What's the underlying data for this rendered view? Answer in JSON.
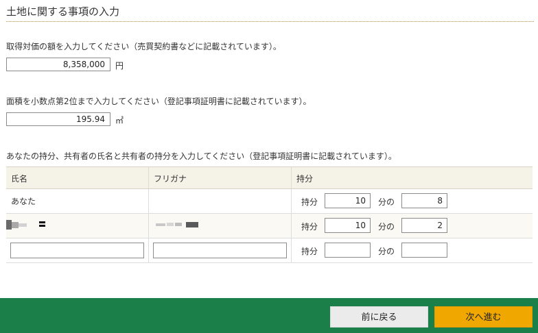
{
  "page": {
    "title": "土地に関する事項の入力"
  },
  "acquisition": {
    "prompt": "取得対価の額を入力してください（売買契約書などに記載されています）。",
    "value": "8,358,000",
    "unit": "円"
  },
  "area": {
    "prompt": "面積を小数点第2位まで入力してください（登記事項証明書に記載されています）。",
    "value": "195.94",
    "unit": "㎡"
  },
  "share": {
    "prompt": "あなたの持分、共有者の氏名と共有者の持分を入力してください（登記事項証明書に記載されています）。",
    "headers": {
      "name": "氏名",
      "furigana": "フリガナ",
      "share": "持分"
    },
    "share_label": "持分",
    "of_label": "分の",
    "rows": [
      {
        "name": "あなた",
        "furigana": "",
        "denominator": "10",
        "numerator": "8"
      },
      {
        "name": "",
        "furigana": "",
        "denominator": "10",
        "numerator": "2"
      },
      {
        "name": "",
        "furigana": "",
        "denominator": "",
        "numerator": ""
      }
    ]
  },
  "footer": {
    "back_label": "前に戻る",
    "next_label": "次へ進む"
  },
  "colors": {
    "footer_bg": "#1a7f49",
    "next_button": "#f0a800",
    "back_button": "#ebebeb",
    "table_header_bg": "#f5f2e8"
  }
}
